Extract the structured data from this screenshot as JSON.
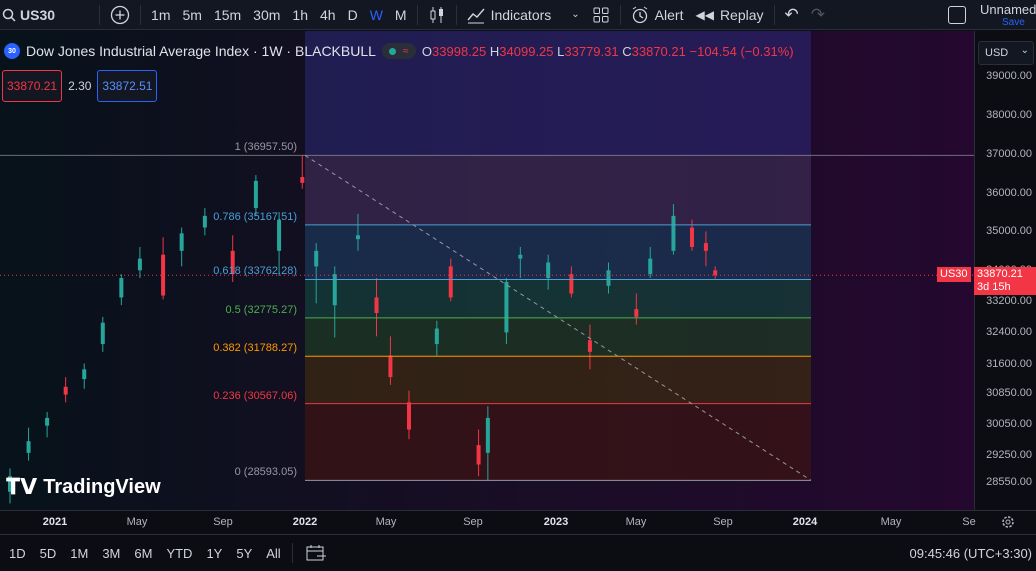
{
  "toolbar": {
    "symbol": "US30",
    "intervals": [
      "1m",
      "5m",
      "15m",
      "30m",
      "1h",
      "4h",
      "D",
      "W",
      "M"
    ],
    "active_interval": "W",
    "indicators_label": "Indicators",
    "alert_label": "Alert",
    "replay_label": "Replay",
    "layout_name": "Unnamed",
    "save_label": "Save"
  },
  "legend": {
    "badge": "30",
    "title": "Dow Jones Industrial Average Index · 1W · BLACKBULL",
    "o_label": "O",
    "o": "33998.25",
    "h_label": "H",
    "h": "34099.25",
    "l_label": "L",
    "l": "33779.31",
    "c_label": "C",
    "c": "33870.21",
    "change": "−104.54 (−0.31%)",
    "sell_price": "33870.21",
    "spread": "2.30",
    "buy_price": "33872.51"
  },
  "price_axis": {
    "currency": "USD",
    "ticks": [
      "39000.00",
      "38000.00",
      "37000.00",
      "36000.00",
      "35000.00",
      "34000.00",
      "33200.00",
      "32400.00",
      "31600.00",
      "30850.00",
      "30050.00",
      "29250.00",
      "28550.00"
    ],
    "current_symbol": "US30",
    "current_price": "33870.21",
    "countdown": "3d 15h"
  },
  "time_axis": {
    "ticks": [
      {
        "label": "2021",
        "bold": true
      },
      {
        "label": "May",
        "bold": false
      },
      {
        "label": "Sep",
        "bold": false
      },
      {
        "label": "2022",
        "bold": true
      },
      {
        "label": "May",
        "bold": false
      },
      {
        "label": "Sep",
        "bold": false
      },
      {
        "label": "2023",
        "bold": true
      },
      {
        "label": "May",
        "bold": false
      },
      {
        "label": "Sep",
        "bold": false
      },
      {
        "label": "2024",
        "bold": true
      },
      {
        "label": "May",
        "bold": false
      },
      {
        "label": "Se",
        "bold": false
      }
    ]
  },
  "fib_levels": [
    {
      "label": "1 (36957.50)",
      "price": 36957.5,
      "color": "#9598a1"
    },
    {
      "label": "0.786 (35167.51)",
      "price": 35167.51,
      "color": "#4a9fd4"
    },
    {
      "label": "0.618 (33762.28)",
      "price": 33762.28,
      "color": "#4a9fd4"
    },
    {
      "label": "0.5 (32775.27)",
      "price": 32775.27,
      "color": "#4caf50"
    },
    {
      "label": "0.382 (31788.27)",
      "price": 31788.27,
      "color": "#ff9800"
    },
    {
      "label": "0.236 (30567.06)",
      "price": 30567.06,
      "color": "#f23645"
    },
    {
      "label": "0 (28593.05)",
      "price": 28593.05,
      "color": "#9598a1"
    }
  ],
  "chart_data": {
    "type": "candlestick",
    "symbol": "US30",
    "interval": "1W",
    "ylim": [
      28200,
      39600
    ],
    "x_range": [
      "2020-10-19",
      "2024-10-14"
    ],
    "weeks": [
      {
        "date": "2020-10-19",
        "o": 28300,
        "h": 28900,
        "l": 28000,
        "c": 28700
      },
      {
        "date": "2020-11-16",
        "o": 29300,
        "h": 29950,
        "l": 29100,
        "c": 29600
      },
      {
        "date": "2020-12-14",
        "o": 30000,
        "h": 30350,
        "l": 29700,
        "c": 30200
      },
      {
        "date": "2021-01-11",
        "o": 31000,
        "h": 31250,
        "l": 30600,
        "c": 30800
      },
      {
        "date": "2021-02-08",
        "o": 31200,
        "h": 31600,
        "l": 30950,
        "c": 31450
      },
      {
        "date": "2021-03-08",
        "o": 32100,
        "h": 32800,
        "l": 31900,
        "c": 32650
      },
      {
        "date": "2021-04-05",
        "o": 33300,
        "h": 33900,
        "l": 33100,
        "c": 33800
      },
      {
        "date": "2021-05-03",
        "o": 34000,
        "h": 34600,
        "l": 33800,
        "c": 34300
      },
      {
        "date": "2021-06-07",
        "o": 34400,
        "h": 34850,
        "l": 33250,
        "c": 33350
      },
      {
        "date": "2021-07-05",
        "o": 34500,
        "h": 35100,
        "l": 34100,
        "c": 34950
      },
      {
        "date": "2021-08-09",
        "o": 35100,
        "h": 35600,
        "l": 34900,
        "c": 35400
      },
      {
        "date": "2021-09-20",
        "o": 34500,
        "h": 34900,
        "l": 33700,
        "c": 33900
      },
      {
        "date": "2021-10-25",
        "o": 35600,
        "h": 36450,
        "l": 35400,
        "c": 36300
      },
      {
        "date": "2021-11-29",
        "o": 34500,
        "h": 35500,
        "l": 33850,
        "c": 35300
      },
      {
        "date": "2022-01-03",
        "o": 36400,
        "h": 36957.5,
        "l": 36100,
        "c": 36250
      },
      {
        "date": "2022-01-24",
        "o": 34100,
        "h": 34700,
        "l": 33150,
        "c": 34500
      },
      {
        "date": "2022-02-21",
        "o": 33100,
        "h": 34100,
        "l": 32270,
        "c": 33900
      },
      {
        "date": "2022-03-28",
        "o": 34800,
        "h": 35450,
        "l": 34500,
        "c": 34900
      },
      {
        "date": "2022-04-25",
        "o": 33300,
        "h": 33800,
        "l": 32300,
        "c": 32900
      },
      {
        "date": "2022-05-16",
        "o": 31800,
        "h": 32300,
        "l": 31050,
        "c": 31250
      },
      {
        "date": "2022-06-13",
        "o": 30600,
        "h": 30900,
        "l": 29650,
        "c": 29900
      },
      {
        "date": "2022-07-25",
        "o": 32100,
        "h": 32700,
        "l": 31800,
        "c": 32500
      },
      {
        "date": "2022-08-15",
        "o": 34100,
        "h": 34300,
        "l": 33200,
        "c": 33300
      },
      {
        "date": "2022-09-26",
        "o": 29500,
        "h": 29900,
        "l": 28700,
        "c": 29000
      },
      {
        "date": "2022-10-10",
        "o": 29300,
        "h": 30500,
        "l": 28593.05,
        "c": 30200
      },
      {
        "date": "2022-11-07",
        "o": 32400,
        "h": 33800,
        "l": 32100,
        "c": 33700
      },
      {
        "date": "2022-11-28",
        "o": 34300,
        "h": 34600,
        "l": 33800,
        "c": 34400
      },
      {
        "date": "2023-01-09",
        "o": 33800,
        "h": 34400,
        "l": 33500,
        "c": 34200
      },
      {
        "date": "2023-02-13",
        "o": 33900,
        "h": 34100,
        "l": 33300,
        "c": 33400
      },
      {
        "date": "2023-03-13",
        "o": 32200,
        "h": 32600,
        "l": 31450,
        "c": 31900
      },
      {
        "date": "2023-04-10",
        "o": 33600,
        "h": 34200,
        "l": 33400,
        "c": 34000
      },
      {
        "date": "2023-05-22",
        "o": 33000,
        "h": 33400,
        "l": 32600,
        "c": 32800
      },
      {
        "date": "2023-06-12",
        "o": 33900,
        "h": 34600,
        "l": 33800,
        "c": 34300
      },
      {
        "date": "2023-07-17",
        "o": 34500,
        "h": 35700,
        "l": 34400,
        "c": 35400
      },
      {
        "date": "2023-08-14",
        "o": 35100,
        "h": 35300,
        "l": 34500,
        "c": 34600
      },
      {
        "date": "2023-09-04",
        "o": 34700,
        "h": 35000,
        "l": 34100,
        "c": 34500
      },
      {
        "date": "2023-09-18",
        "o": 33998.25,
        "h": 34099.25,
        "l": 33779.31,
        "c": 33870.21
      }
    ]
  }
}
